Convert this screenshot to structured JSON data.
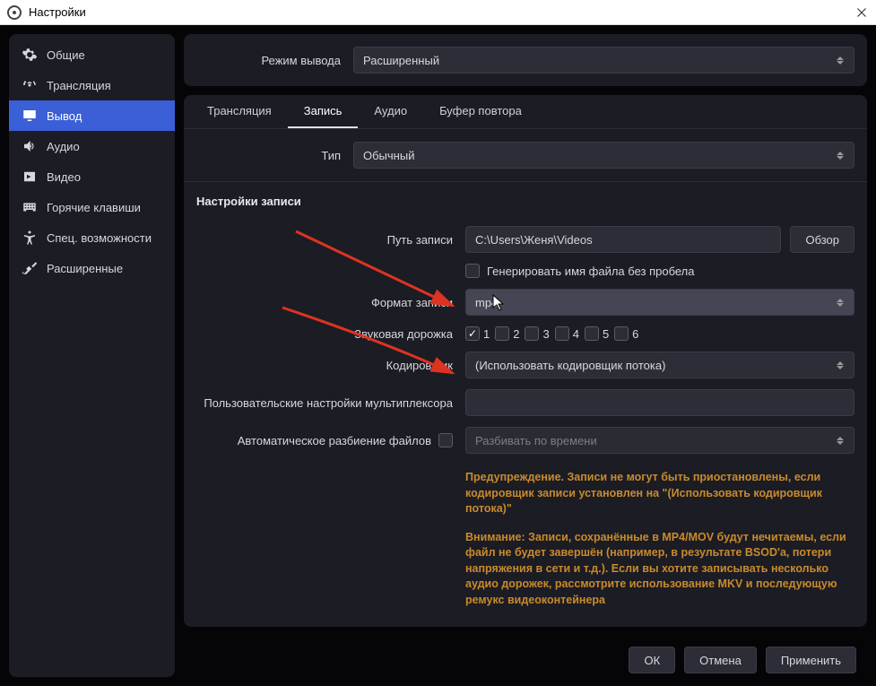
{
  "window": {
    "title": "Настройки"
  },
  "sidebar": {
    "items": [
      {
        "label": "Общие"
      },
      {
        "label": "Трансляция"
      },
      {
        "label": "Вывод"
      },
      {
        "label": "Аудио"
      },
      {
        "label": "Видео"
      },
      {
        "label": "Горячие клавиши"
      },
      {
        "label": "Спец. возможности"
      },
      {
        "label": "Расширенные"
      }
    ]
  },
  "header": {
    "mode_label": "Режим вывода",
    "mode_value": "Расширенный"
  },
  "tabs": [
    {
      "label": "Трансляция"
    },
    {
      "label": "Запись"
    },
    {
      "label": "Аудио"
    },
    {
      "label": "Буфер повтора"
    }
  ],
  "type_row": {
    "label": "Тип",
    "value": "Обычный"
  },
  "section": {
    "title": "Настройки записи",
    "path_label": "Путь записи",
    "path_value": "C:\\Users\\Женя\\Videos",
    "browse_label": "Обзор",
    "nospace_label": "Генерировать имя файла без пробела",
    "format_label": "Формат записи",
    "format_value": "mp4",
    "tracks_label": "Звуковая дорожка",
    "tracks": [
      "1",
      "2",
      "3",
      "4",
      "5",
      "6"
    ],
    "tracks_checked": [
      true,
      false,
      false,
      false,
      false,
      false
    ],
    "encoder_label": "Кодировщик",
    "encoder_value": "(Использовать кодировщик потока)",
    "mux_label": "Пользовательские настройки мультиплексора",
    "mux_value": "",
    "autosplit_label": "Автоматическое разбиение файлов",
    "autosplit_select_placeholder": "Разбивать по времени"
  },
  "warning": {
    "p1": "Предупреждение. Записи не могут быть приостановлены, если кодировщик записи установлен на \"(Использовать кодировщик потока)\"",
    "p2": "Внимание: Записи, сохранённые в MP4/MOV будут нечитаемы, если файл не будет завершён (например, в результате BSOD'а, потери напряжения в сети и т.д.). Если вы хотите записывать несколько аудио дорожек, рассмотрите использование MKV и последующую ремукс видеоконтейнера"
  },
  "footer": {
    "ok": "ОК",
    "cancel": "Отмена",
    "apply": "Применить"
  }
}
